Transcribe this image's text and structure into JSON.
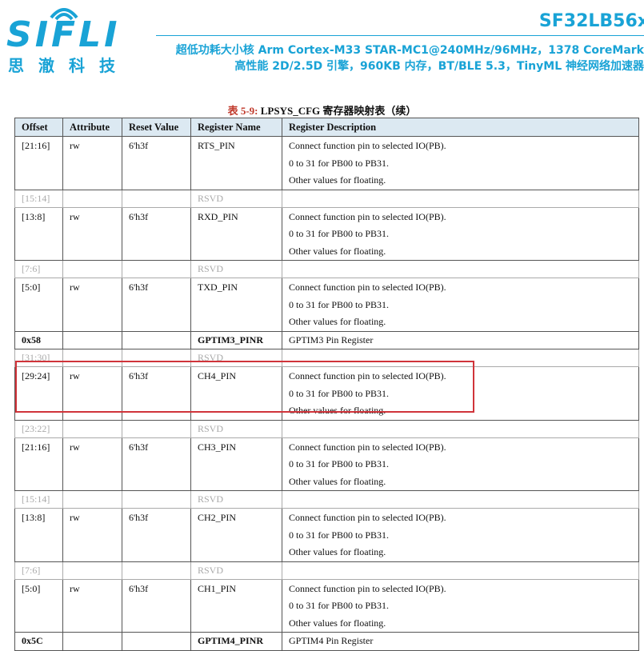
{
  "header": {
    "logo_text": "SIFLI",
    "logo_cn": "思澈科技",
    "doc_title": "SF32LB56x",
    "subtitle_line1": "超低功耗大小核 Arm Cortex-M33 STAR-MC1@240MHz/96MHz，1378 CoreMark",
    "subtitle_line2": "高性能 2D/2.5D 引擎，960KB 内存，BT/BLE 5.3，TinyML 神经网络加速器",
    "brand_color": "#19a3d6"
  },
  "caption": {
    "label": "表 5-9:",
    "text": "LPSYS_CFG 寄存器映射表（续）"
  },
  "table": {
    "headers": [
      "Offset",
      "Attribute",
      "Reset Value",
      "Register Name",
      "Register Description"
    ],
    "rows": [
      {
        "type": "field",
        "offset": "[21:16]",
        "attr": "rw",
        "reset": "6'h3f",
        "name": "RTS_PIN",
        "desc": [
          "Connect function pin to selected IO(PB).",
          "0 to 31 for PB00 to PB31.",
          "Other values for floating."
        ]
      },
      {
        "type": "rsvd",
        "offset": "[15:14]",
        "name": "RSVD"
      },
      {
        "type": "field",
        "offset": "[13:8]",
        "attr": "rw",
        "reset": "6'h3f",
        "name": "RXD_PIN",
        "desc": [
          "Connect function pin to selected IO(PB).",
          "0 to 31 for PB00 to PB31.",
          "Other values for floating."
        ]
      },
      {
        "type": "rsvd",
        "offset": "[7:6]",
        "name": "RSVD"
      },
      {
        "type": "field",
        "offset": "[5:0]",
        "attr": "rw",
        "reset": "6'h3f",
        "name": "TXD_PIN",
        "desc": [
          "Connect function pin to selected IO(PB).",
          "0 to 31 for PB00 to PB31.",
          "Other values for floating."
        ]
      },
      {
        "type": "reg",
        "offset": "0x58",
        "name": "GPTIM3_PINR",
        "desc": [
          "GPTIM3 Pin Register"
        ]
      },
      {
        "type": "rsvd",
        "offset": "[31:30]",
        "name": "RSVD"
      },
      {
        "type": "field",
        "offset": "[29:24]",
        "attr": "rw",
        "reset": "6'h3f",
        "name": "CH4_PIN",
        "desc": [
          "Connect function pin to selected IO(PB).",
          "0 to 31 for PB00 to PB31.",
          "Other values for floating."
        ],
        "highlighted": true
      },
      {
        "type": "rsvd",
        "offset": "[23:22]",
        "name": "RSVD"
      },
      {
        "type": "field",
        "offset": "[21:16]",
        "attr": "rw",
        "reset": "6'h3f",
        "name": "CH3_PIN",
        "desc": [
          "Connect function pin to selected IO(PB).",
          "0 to 31 for PB00 to PB31.",
          "Other values for floating."
        ]
      },
      {
        "type": "rsvd",
        "offset": "[15:14]",
        "name": "RSVD"
      },
      {
        "type": "field",
        "offset": "[13:8]",
        "attr": "rw",
        "reset": "6'h3f",
        "name": "CH2_PIN",
        "desc": [
          "Connect function pin to selected IO(PB).",
          "0 to 31 for PB00 to PB31.",
          "Other values for floating."
        ]
      },
      {
        "type": "rsvd",
        "offset": "[7:6]",
        "name": "RSVD"
      },
      {
        "type": "field",
        "offset": "[5:0]",
        "attr": "rw",
        "reset": "6'h3f",
        "name": "CH1_PIN",
        "desc": [
          "Connect function pin to selected IO(PB).",
          "0 to 31 for PB00 to PB31.",
          "Other values for floating."
        ]
      },
      {
        "type": "reg",
        "offset": "0x5C",
        "name": "GPTIM4_PINR",
        "desc": [
          "GPTIM4 Pin Register"
        ]
      }
    ]
  },
  "highlight_color": "#d0343a"
}
